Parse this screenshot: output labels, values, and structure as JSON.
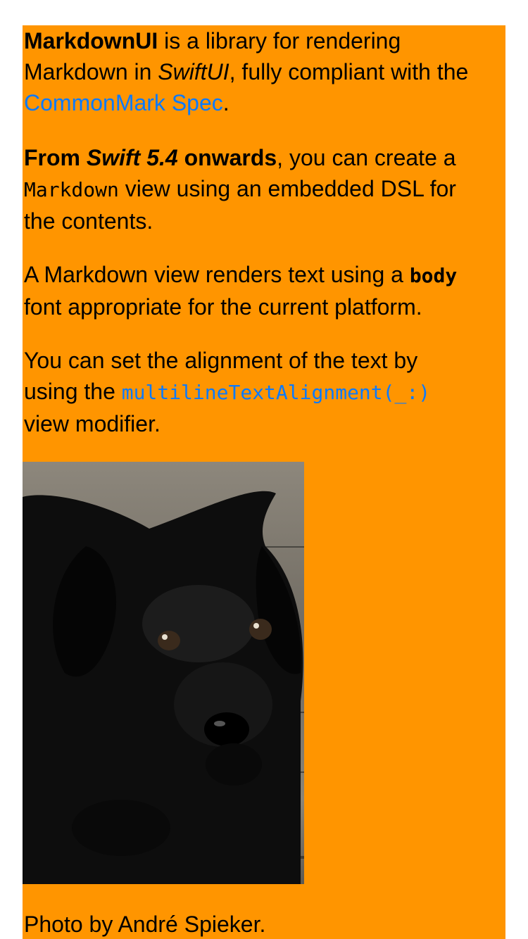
{
  "colors": {
    "card_background": "#FF9500",
    "link": "#0A7AFF",
    "text": "#000000"
  },
  "paragraph_1": {
    "strong_name": "MarkdownUI",
    "text_1": " is a library for rendering",
    "text_2": "Markdown in ",
    "emphasis": "SwiftUI",
    "text_3": ", fully compliant with the",
    "link": "CommonMark Spec",
    "text_4": "."
  },
  "paragraph_2": {
    "strong_1": "From ",
    "strong_emphasis": "Swift 5.4",
    "strong_2": " onwards",
    "text_1": ", you can create a",
    "code": "Markdown",
    "text_2": " view using an embedded DSL for",
    "text_3": "the contents."
  },
  "paragraph_3": {
    "text_1": "A Markdown view renders text using a ",
    "code_strong": "body",
    "text_2": "font appropriate for the current platform."
  },
  "paragraph_4": {
    "text_1": "You can set the alignment of the text by",
    "text_2": "using the ",
    "code_link": "multilineTextAlignment(_:)",
    "text_3": "view modifier."
  },
  "image": {
    "icon": "puppy-photo"
  },
  "caption": {
    "text": "Photo by André Spieker."
  }
}
